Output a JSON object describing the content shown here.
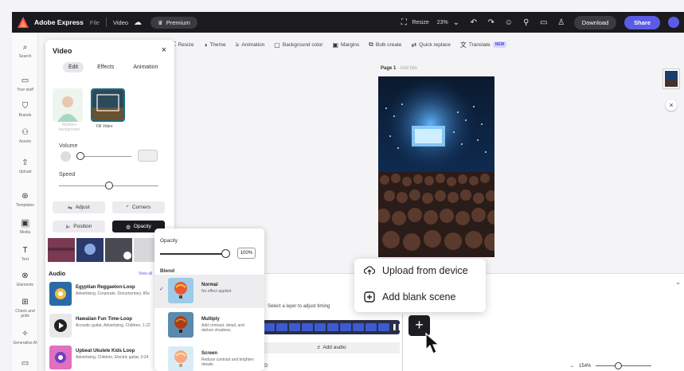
{
  "topbar": {
    "brand": "Adobe Express",
    "file": "File",
    "doc": "Video",
    "premium": "Premium",
    "resize": "Resize",
    "zoom": "23%",
    "download": "Download",
    "share": "Share"
  },
  "rail": [
    {
      "label": "Search",
      "icon": "search-icon"
    },
    {
      "label": "Your stuff",
      "icon": "folder-icon"
    },
    {
      "label": "Brands",
      "icon": "brand-icon"
    },
    {
      "label": "Assets",
      "icon": "assets-icon"
    },
    {
      "label": "Upload",
      "icon": "upload-icon"
    },
    {
      "label": "Templates",
      "icon": "templates-icon"
    },
    {
      "label": "Media",
      "icon": "media-icon"
    },
    {
      "label": "Text",
      "icon": "text-icon"
    },
    {
      "label": "Elements",
      "icon": "elements-icon"
    },
    {
      "label": "Charts and grids",
      "icon": "grid-icon"
    },
    {
      "label": "Generative AI",
      "icon": "sparkle-icon"
    },
    {
      "label": "",
      "icon": "more-icon"
    }
  ],
  "ctoolbar": [
    "Resize",
    "Theme",
    "Animation",
    "Background color",
    "Margins",
    "Bulk create",
    "Quick replace",
    "Translate"
  ],
  "ctoolbar_new": "NEW",
  "canvas": {
    "page_label": "Page 1",
    "page_sub": "Add title"
  },
  "popup": {
    "upload": "Upload from device",
    "blank": "Add blank scene"
  },
  "timeline": {
    "hint": "Select a layer to adjust timing",
    "add_audio": "Add audio",
    "zoom": "154%"
  },
  "video_panel": {
    "title": "Video",
    "tabs": [
      "Edit",
      "Effects",
      "Animation"
    ],
    "card1_label": "Replace background",
    "card2_label": "Fill Video",
    "volume": "Volume",
    "volume_value": "0%",
    "speed": "Speed",
    "speed_level": 0.5,
    "adjust": "Adjust",
    "corners": "Corners",
    "position": "Position",
    "opacity": "Opacity",
    "audio_heading": "Audio",
    "view_all": "View all",
    "audio": [
      {
        "name": "Egyptian Reggaeton-Loop",
        "desc": "Advertising, Corporate, Documentary, 80s"
      },
      {
        "name": "Hawaiian Fun Time-Loop",
        "desc": "Acoustic guitar, Advertising, Children, 1:22"
      },
      {
        "name": "Upbeat Ukulele Kids Loop",
        "desc": "Advertising, Children, Electric guitar, 0:24"
      }
    ]
  },
  "opacity_panel": {
    "title": "Opacity",
    "value": "100%",
    "blend_heading": "Blend",
    "modes": [
      {
        "name": "Normal",
        "desc": "No effect applied",
        "selected": true
      },
      {
        "name": "Multiply",
        "desc": "Add contrast, detail, and darken shadows.",
        "selected": false
      },
      {
        "name": "Screen",
        "desc": "Reduce contrast and brighten details.",
        "selected": false
      }
    ]
  },
  "colors": {
    "accent": "#5b5ce6",
    "topbar": "#1b1b1f",
    "timeline_track": "#2a2e4a"
  }
}
